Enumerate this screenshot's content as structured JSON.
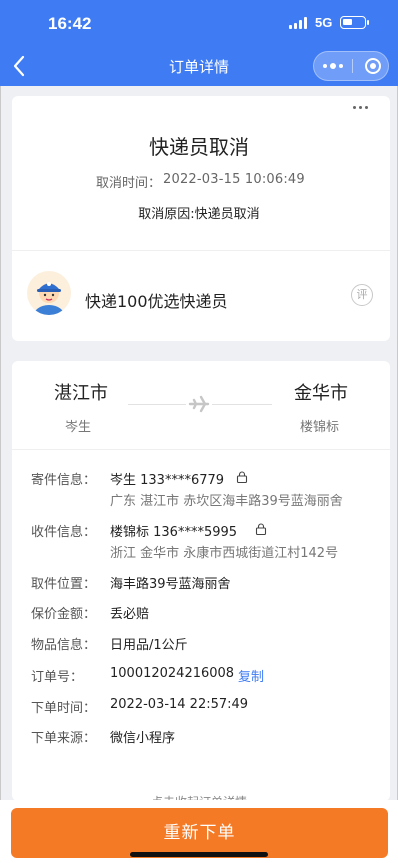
{
  "status_bar": {
    "time": "16:42",
    "network": "5G"
  },
  "nav": {
    "title": "订单详情"
  },
  "cancel": {
    "title": "快递员取消",
    "time_label": "取消时间：",
    "time_value": "2022-03-15 10:06:49",
    "reason": "取消原因:快递员取消"
  },
  "courier": {
    "name": "快递100优选快递员",
    "rate_label": "评"
  },
  "route": {
    "from_city": "湛江市",
    "from_person": "岑生",
    "to_city": "金华市",
    "to_person": "楼锦标"
  },
  "details": {
    "sender": {
      "label": "寄件信息：",
      "contact": "岑生 133****6779",
      "address": "广东 湛江市 赤坎区海丰路39号蓝海丽舍"
    },
    "receiver": {
      "label": "收件信息：",
      "contact": "楼锦标 136****5995",
      "address": "浙江 金华市 永康市西城街道江村142号"
    },
    "pickup": {
      "label": "取件位置：",
      "value": "海丰路39号蓝海丽舍"
    },
    "insurance": {
      "label": "保价金额：",
      "value": "丢必赔"
    },
    "item": {
      "label": "物品信息：",
      "value": "日用品/1公斤"
    },
    "order_no": {
      "label": "订单号：",
      "value": "100012024216008",
      "copy_label": "复制"
    },
    "order_time": {
      "label": "下单时间：",
      "value": "2022-03-14 22:57:49"
    },
    "source": {
      "label": "下单来源：",
      "value": "微信小程序"
    }
  },
  "expand_text": "点击收起订单详情",
  "reorder_button": "重新下单",
  "colors": {
    "primary": "#3f7cf4",
    "accent": "#f47a25"
  }
}
